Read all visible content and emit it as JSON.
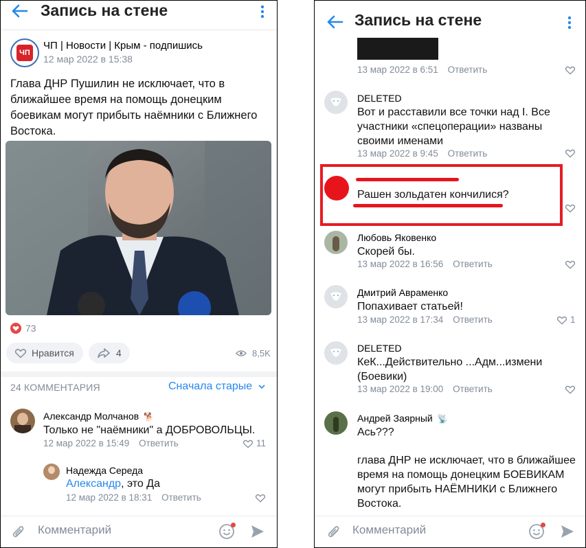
{
  "left": {
    "title": "Запись на стене",
    "post": {
      "author": "ЧП | Новости | Крым - подпишись",
      "date": "12 мар 2022 в 15:38",
      "text": "Глава ДНР Пушилин не исключает, что в ближайшее время на помощь донецким боевикам могут прибыть наёмники с Ближнего Востока.",
      "reactions": "73",
      "like_label": "Нравится",
      "share_count": "4",
      "views": "8,5K",
      "logo_text": "ЧП"
    },
    "comments_header": "24 КОММЕНТАРИЯ",
    "sort_label": "Сначала старые",
    "comments": [
      {
        "author": "Александр Молчанов",
        "text": "Только не \"наёмники\" а ДОБРОВОЛЬЦЫ.",
        "date": "12 мар 2022 в 15:49",
        "reply": "Ответить",
        "likes": "11"
      },
      {
        "author": "Надежда Середа",
        "mention": "Александр",
        "text": ", это Да",
        "date": "12 мар 2022 в 18:31",
        "reply": "Ответить"
      }
    ],
    "comment_placeholder": "Комментарий"
  },
  "right": {
    "title": "Запись на стене",
    "top_item": {
      "date": "13 мар 2022 в 6:51",
      "reply": "Ответить"
    },
    "comments": [
      {
        "author": "DELETED",
        "text": "Вот и расставили все точки над I. Все участники «спецоперации» названы своими именами",
        "date": "13 мар 2022 в 9:45",
        "reply": "Ответить"
      },
      {
        "text": "Рашен зольдатен кончилися?"
      },
      {
        "author": "Любовь Яковенко",
        "text": "Скорей бы.",
        "date": "13 мар 2022 в 16:56",
        "reply": "Ответить"
      },
      {
        "author": "Дмитрий Авраменко",
        "text": "Попахивает статьей!",
        "date": "13 мар 2022 в 17:34",
        "reply": "Ответить",
        "likes": "1"
      },
      {
        "author": "DELETED",
        "text": "КеК...Действительно ...Адм...измени (Боевики)",
        "date": "13 мар 2022 в 19:00",
        "reply": "Ответить"
      },
      {
        "author": "Андрей Заярный",
        "text": "Ась???",
        "text2": "глава ДНР не исключает, что в ближайшее время на помощь донецким БОЕВИКАМ могут прибыть НАЁМНИКИ с Ближнего Востока."
      }
    ],
    "comment_placeholder": "Комментарий"
  }
}
